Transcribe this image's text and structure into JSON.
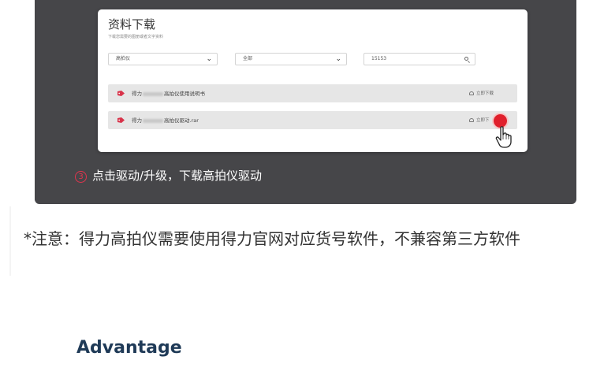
{
  "card": {
    "title": "资料下载",
    "subtitle": "下载您需要的图册或者文字资料"
  },
  "filters": {
    "category": {
      "value": "高拍仪"
    },
    "type": {
      "value": "全部"
    },
    "search": {
      "value": "15153"
    }
  },
  "files": [
    {
      "prefix": "得力",
      "suffix": "高拍仪使用说明书",
      "action": "立即下载"
    },
    {
      "prefix": "得力",
      "suffix": "高拍仪驱动.rar",
      "action": "立即下"
    }
  ],
  "step": {
    "number": "3",
    "text": "点击驱动/升级，下载高拍仪驱动"
  },
  "note": "*注意：得力高拍仪需要使用得力官网对应货号软件，不兼容第三方软件",
  "advantage_heading": "Advantage",
  "colors": {
    "panel": "#464649",
    "accent_red": "#e0202c",
    "heading_navy": "#1f3a57"
  }
}
